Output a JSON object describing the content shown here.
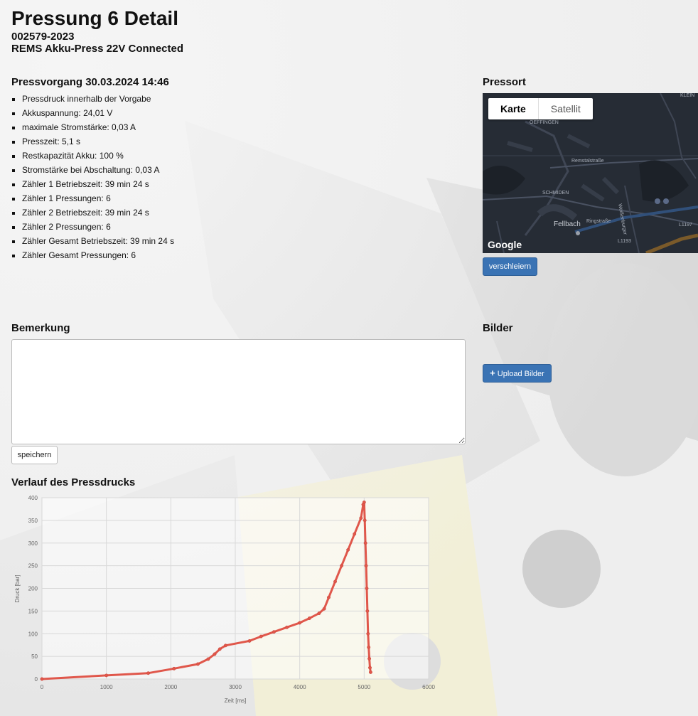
{
  "header": {
    "title": "Pressung 6 Detail",
    "order_number": "002579-2023",
    "device": "REMS Akku-Press 22V Connected"
  },
  "press_process": {
    "title": "Pressvorgang 30.03.2024 14:46",
    "items": [
      "Pressdruck innerhalb der Vorgabe",
      "Akkuspannung: 24,01 V",
      "maximale Stromstärke: 0,03 A",
      "Presszeit: 5,1 s",
      "Restkapazität Akku: 100 %",
      "Stromstärke bei Abschaltung: 0,03 A",
      "Zähler 1 Betriebszeit: 39 min 24 s",
      "Zähler 1 Pressungen: 6",
      "Zähler 2 Betriebszeit: 39 min 24 s",
      "Zähler 2 Pressungen: 6",
      "Zähler Gesamt Betriebszeit: 39 min 24 s",
      "Zähler Gesamt Pressungen: 6"
    ]
  },
  "location": {
    "title": "Pressort",
    "map_tabs": [
      "Karte",
      "Satellit"
    ],
    "active_tab": "Karte",
    "map_labels": [
      "OEFFINGEN",
      "Remstalstraße",
      "SCHMIDEN",
      "Fellbach",
      "Ringstraße",
      "Weißenburger",
      "L1193",
      "L1197",
      "KLEIN"
    ],
    "logo": "Google",
    "obscure_button": "verschleiern"
  },
  "remark": {
    "title": "Bemerkung",
    "value": "",
    "save_button": "speichern"
  },
  "images": {
    "title": "Bilder",
    "upload_button": "Upload Bilder"
  },
  "colors": {
    "primary_button": "#3a73b4",
    "series_line": "#e0574b",
    "map_bg": "#242a33"
  },
  "chart_title": "Verlauf des Pressdrucks",
  "chart_data": {
    "type": "line",
    "xlabel": "Zeit [ms]",
    "ylabel": "Druck [bar]",
    "xlim": [
      0,
      6000
    ],
    "ylim": [
      0,
      400
    ],
    "xticks": [
      0,
      1000,
      2000,
      3000,
      4000,
      5000,
      6000
    ],
    "yticks": [
      0,
      50,
      100,
      150,
      200,
      250,
      300,
      350,
      400
    ],
    "grid": true,
    "series": [
      {
        "x": [
          0,
          1000,
          1650,
          2050,
          2420,
          2580,
          2680,
          2760,
          2850,
          3220,
          3400,
          3600,
          3800,
          4000,
          4150,
          4300,
          4380,
          4450,
          4550,
          4650,
          4750,
          4850,
          4950,
          4985,
          5000,
          5010,
          5020,
          5030,
          5040,
          5050,
          5060,
          5070,
          5080,
          5090,
          5100
        ],
        "y": [
          0,
          8,
          13,
          23,
          33,
          44,
          55,
          66,
          74,
          84,
          94,
          104,
          114,
          124,
          134,
          145,
          155,
          180,
          215,
          250,
          285,
          320,
          355,
          385,
          390,
          350,
          300,
          250,
          200,
          150,
          100,
          70,
          45,
          25,
          15
        ]
      }
    ]
  }
}
